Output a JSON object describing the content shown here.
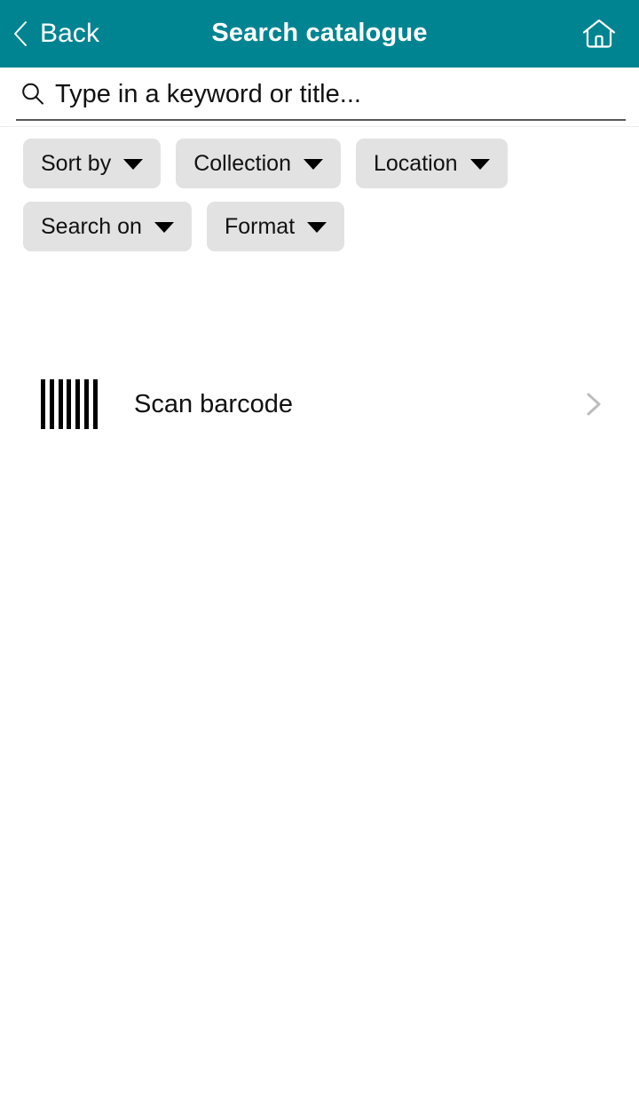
{
  "theme": {
    "header_bg": "#008491",
    "header_text": "#ffffff",
    "chip_bg": "#e2e2e2",
    "chip_text": "#111111",
    "body_bg": "#ffffff",
    "underline": "#58585a",
    "chevron_gray": "#bdbdbd"
  },
  "header": {
    "back_label": "Back",
    "title": "Search catalogue",
    "back_icon": "chevron-left-icon",
    "home_icon": "home-icon"
  },
  "search": {
    "placeholder": "Type in a keyword or title...",
    "value": "",
    "icon": "search-icon"
  },
  "filters": {
    "rows": [
      [
        {
          "label": "Sort by",
          "icon": "chevron-down-icon"
        },
        {
          "label": "Collection",
          "icon": "chevron-down-icon"
        },
        {
          "label": "Location",
          "icon": "chevron-down-icon"
        }
      ],
      [
        {
          "label": "Search on",
          "icon": "chevron-down-icon"
        },
        {
          "label": "Format",
          "icon": "chevron-down-icon"
        }
      ]
    ]
  },
  "actions": {
    "scan": {
      "label": "Scan barcode",
      "icon": "barcode-icon",
      "accessory_icon": "chevron-right-icon"
    }
  }
}
